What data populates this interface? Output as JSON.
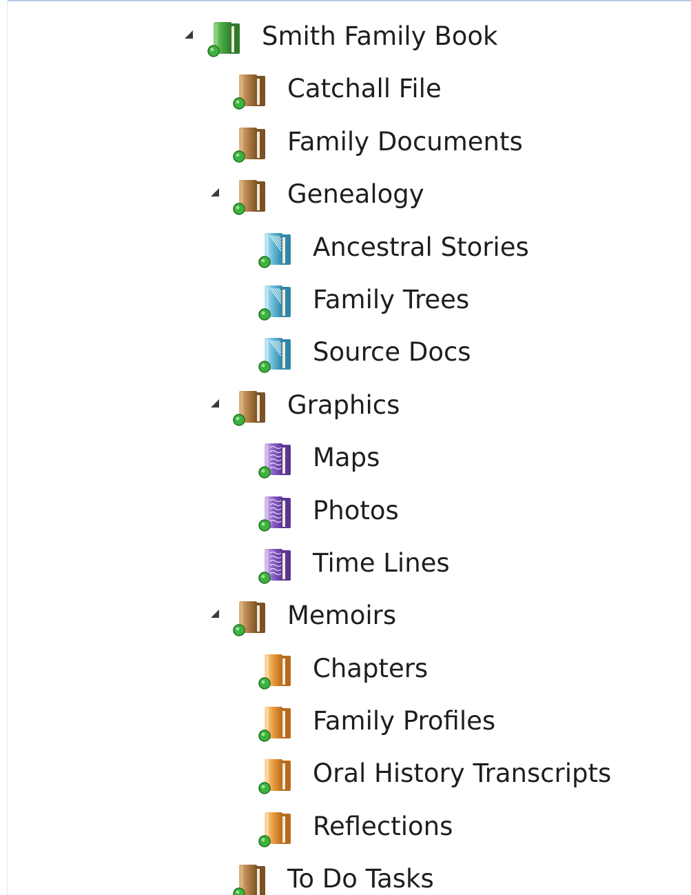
{
  "tree": {
    "root": {
      "label": "Smith Family Book",
      "icon": "book-binder-green-icon"
    },
    "catchall": {
      "label": "Catchall File",
      "icon": "binder-brown-icon"
    },
    "family_documents": {
      "label": "Family Documents",
      "icon": "binder-brown-icon"
    },
    "genealogy": {
      "label": "Genealogy",
      "icon": "binder-brown-icon",
      "children": [
        {
          "label": "Ancestral Stories",
          "icon": "binder-blue-icon"
        },
        {
          "label": "Family Trees",
          "icon": "binder-blue-icon"
        },
        {
          "label": "Source Docs",
          "icon": "binder-blue-icon"
        }
      ]
    },
    "graphics": {
      "label": "Graphics",
      "icon": "binder-brown-icon",
      "children": [
        {
          "label": "Maps",
          "icon": "binder-purple-icon"
        },
        {
          "label": "Photos",
          "icon": "binder-purple-icon"
        },
        {
          "label": "Time Lines",
          "icon": "binder-purple-icon"
        }
      ]
    },
    "memoirs": {
      "label": "Memoirs",
      "icon": "binder-brown-icon",
      "children": [
        {
          "label": "Chapters",
          "icon": "binder-orange-icon"
        },
        {
          "label": "Family Profiles",
          "icon": "binder-orange-icon"
        },
        {
          "label": "Oral History Transcripts",
          "icon": "binder-orange-icon"
        },
        {
          "label": "Reflections",
          "icon": "binder-orange-icon"
        }
      ]
    },
    "to_do_tasks": {
      "label": "To Do Tasks",
      "icon": "binder-brown-icon"
    }
  },
  "colors": {
    "book_green": "#46a640",
    "binder_brown": "#b27e45",
    "binder_blue": "#63b8d6",
    "binder_purple": "#8a5cc8",
    "binder_orange": "#e89a3c",
    "status_dot": "#3eb23e",
    "text": "#1e1e1e",
    "expander": "#3c3c3c"
  }
}
